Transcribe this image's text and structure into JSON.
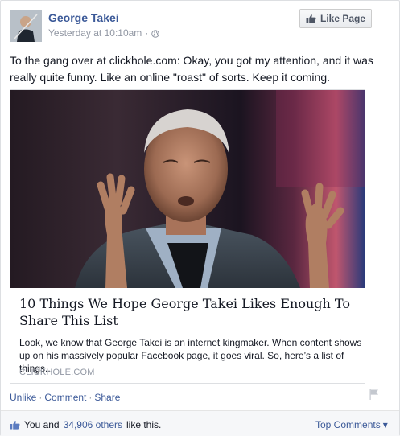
{
  "post": {
    "author": "George Takei",
    "timestamp": "Yesterday at 10:10am",
    "separator": "·",
    "privacy_icon": "globe-icon",
    "message": "To the gang over at clickhole.com: Okay, you got my attention, and it was really quite funny. Like an online \"roast\" of sorts. Keep it coming."
  },
  "like_page": {
    "icon": "thumbs-up-icon",
    "label": "Like Page"
  },
  "attachment": {
    "headline": "10 Things We Hope George Takei Likes Enough To Share This List",
    "summary": "Look, we know that George Takei is an internet kingmaker. When content shows up on his massively popular Facebook page, it goes viral. So, here’s a list of things...",
    "domain": "CLICKHOLE.COM"
  },
  "actions": {
    "unlike": "Unlike",
    "comment": "Comment",
    "share": "Share",
    "dot": "·"
  },
  "likes": {
    "prefix": "You and",
    "count_link": "34,906 others",
    "suffix": "like this.",
    "top_comments": "Top Comments",
    "dropdown_caret": "▾"
  },
  "colors": {
    "link": "#3b5998",
    "meta": "#9197a3",
    "text": "#141823"
  }
}
